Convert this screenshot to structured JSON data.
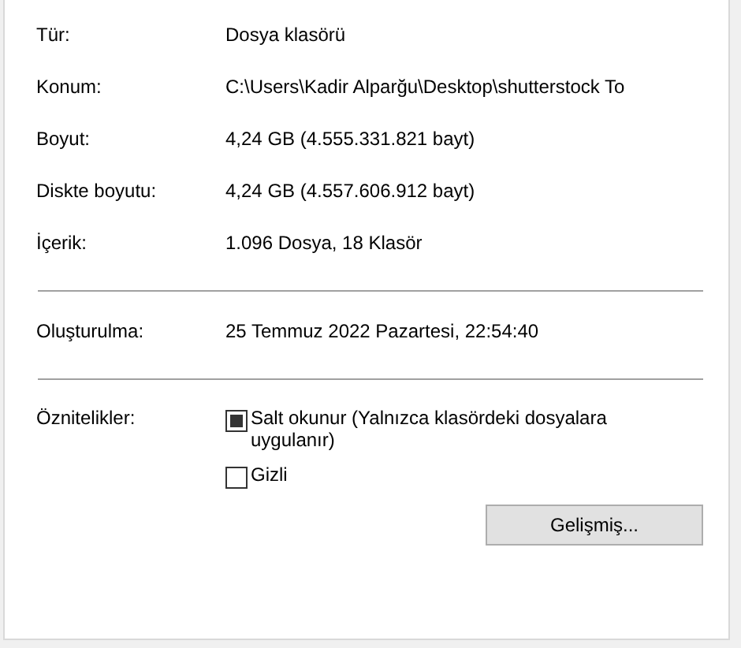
{
  "sections": [
    {
      "rows": [
        {
          "label": "Tür:",
          "value": "Dosya klasörü"
        },
        {
          "label": "Konum:",
          "value": "C:\\Users\\Kadir Alparğu\\Desktop\\shutterstock To"
        },
        {
          "label": "Boyut:",
          "value": "4,24 GB (4.555.331.821 bayt)"
        },
        {
          "label": "Diskte boyutu:",
          "value": "4,24 GB (4.557.606.912 bayt)"
        },
        {
          "label": "İçerik:",
          "value": "1.096 Dosya, 18 Klasör"
        }
      ]
    },
    {
      "rows": [
        {
          "label": "Oluşturulma:",
          "value": "25 Temmuz 2022 Pazartesi, 22:54:40"
        }
      ]
    }
  ],
  "attributes": {
    "label": "Öznitelikler:",
    "options": [
      {
        "label": "Salt okunur (Yalnızca klasördeki dosyalara uygulanır)",
        "checked": false,
        "indeterminate": true
      },
      {
        "label": "Gizli",
        "checked": false,
        "indeterminate": false
      }
    ]
  },
  "button": "Gelişmiş..."
}
